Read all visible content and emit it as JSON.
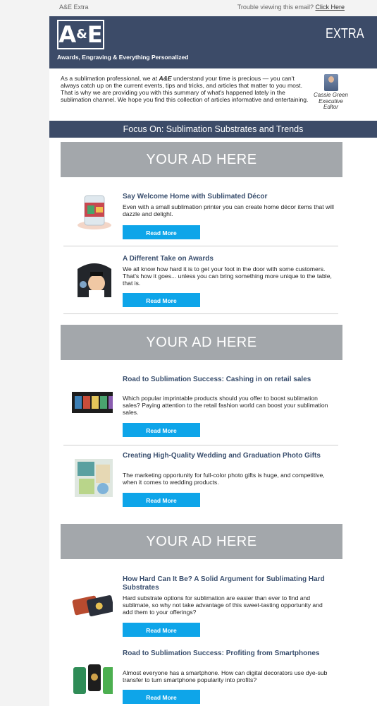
{
  "topbar": {
    "left": "A&E Extra",
    "right_prefix": "Trouble viewing this email?",
    "right_link": "Click Here"
  },
  "header": {
    "logo_a": "A",
    "logo_amp": "&",
    "logo_e": "E",
    "tagline": "Awards, Engraving & Everything Personalized",
    "extra": "EXTRA"
  },
  "intro": {
    "p1": "As a sublimation professional, we at ",
    "brand": "A&E",
    "p2": " understand your time is precious — you can't always catch up on the current events, tips and tricks, and articles that matter to you most. That is why we are providing you with this summary of what's happened lately in the sublimation channel. We hope you find this collection of articles informative and entertaining."
  },
  "editor": {
    "name": "Cassie Green",
    "role": "Executive Editor"
  },
  "focus": "Focus On: Sublimation Substrates and Trends",
  "ad_label": "YOUR AD HERE",
  "read_more": "Read More",
  "articles": [
    {
      "title": "Say Welcome Home with Sublimated Décor",
      "desc": "Even with a small sublimation printer you can create home décor items that will dazzle and delight."
    },
    {
      "title": "A Different Take on Awards",
      "desc": "We all know how hard it is to get your foot in the door with some customers. That's how it goes... unless you can bring something more unique to the table, that is."
    },
    {
      "title": "Road to Sublimation Success: Cashing in on retail sales",
      "desc": "Which popular imprintable products should you offer to boost sublimation sales? Paying attention to the retail fashion world can boost your sublimation sales."
    },
    {
      "title": "Creating High-Quality Wedding and Graduation Photo Gifts",
      "desc": "The marketing opportunity for full-color photo gifts is huge, and competitive, when it comes to wedding products."
    },
    {
      "title": "How Hard Can It Be? A Solid Argument for Sublimating Hard Substrates",
      "desc": "Hard substrate options for sublimation are easier than ever to find and sublimate, so why not take advantage of this sweet-tasting opportunity and add them to your offerings?"
    },
    {
      "title": "Road to Sublimation Success: Profiting from Smartphones",
      "desc": "Almost everyone has a smartphone. How can digital decorators use dye-sub transfer to turn smartphone popularity into profits?"
    }
  ]
}
